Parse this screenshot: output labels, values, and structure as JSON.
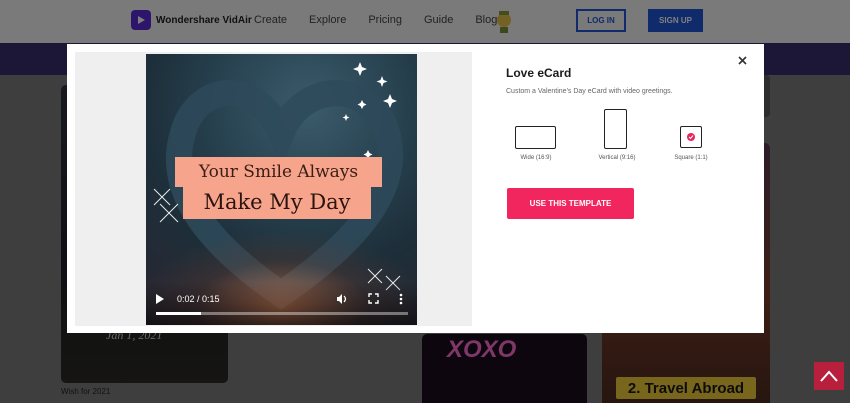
{
  "navbar": {
    "brand": "Wondershare VidAir",
    "links": [
      "Create",
      "Explore",
      "Pricing",
      "Guide",
      "Blog"
    ],
    "login_label": "LOG IN",
    "signup_label": "SIGN UP"
  },
  "background": {
    "card_a_date": "Jan 1, 2021",
    "card_a_caption": "Wish for 2021",
    "card_b_text": "XOXO",
    "card_c_text": "2. Travel Abroad"
  },
  "modal": {
    "title": "Love eCard",
    "description": "Custom a Valentine's Day eCard with video greetings.",
    "close_icon": "close-icon",
    "video": {
      "banner_line1": "Your Smile Always",
      "banner_line2": "Make My Day",
      "time": "0:02 / 0:15",
      "progress": 0.18
    },
    "ratios": [
      {
        "label": "Wide (16:9)"
      },
      {
        "label": "Vertical (9:16)"
      },
      {
        "label": "Square (1:1)"
      }
    ],
    "selected_ratio": "Square (1:1)",
    "use_button": "USE THIS TEMPLATE"
  },
  "colors": {
    "accent": "#f1265e",
    "brand_blue": "#1f57d6",
    "banner": "#f6a58c"
  }
}
